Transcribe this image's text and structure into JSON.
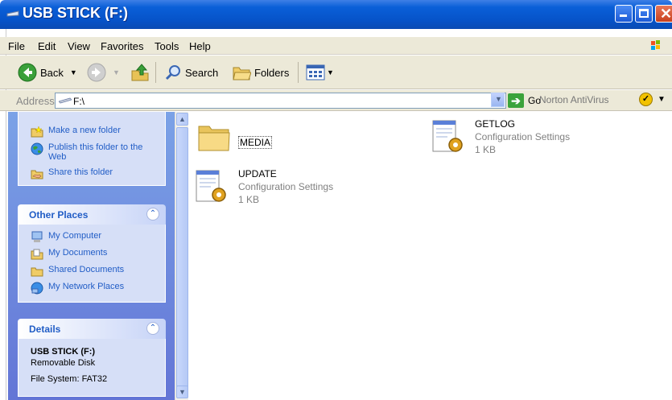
{
  "window": {
    "title": "USB STICK (F:)"
  },
  "menu": [
    "File",
    "Edit",
    "View",
    "Favorites",
    "Tools",
    "Help"
  ],
  "toolbar": {
    "back": "Back",
    "search": "Search",
    "folders": "Folders"
  },
  "address": {
    "label": "Address",
    "value": "F:\\",
    "go": "Go",
    "norton": "Norton AntiVirus"
  },
  "tasks": {
    "items": [
      "Make a new folder",
      "Publish this folder to the Web",
      "Share this folder"
    ]
  },
  "other_places": {
    "header": "Other Places",
    "items": [
      "My Computer",
      "My Documents",
      "Shared Documents",
      "My Network Places"
    ]
  },
  "details": {
    "header": "Details",
    "name": "USB STICK (F:)",
    "type": "Removable Disk",
    "filesystem": "File System: FAT32"
  },
  "files": [
    {
      "name": "MEDIA",
      "kind": "folder"
    },
    {
      "name": "GETLOG",
      "type": "Configuration Settings",
      "size": "1 KB",
      "kind": "config"
    },
    {
      "name": "UPDATE",
      "type": "Configuration Settings",
      "size": "1 KB",
      "kind": "config"
    }
  ],
  "colors": {
    "titlebar": "#0a5fd8",
    "taskpane": "#7ba2e7",
    "link": "#215dc6"
  }
}
